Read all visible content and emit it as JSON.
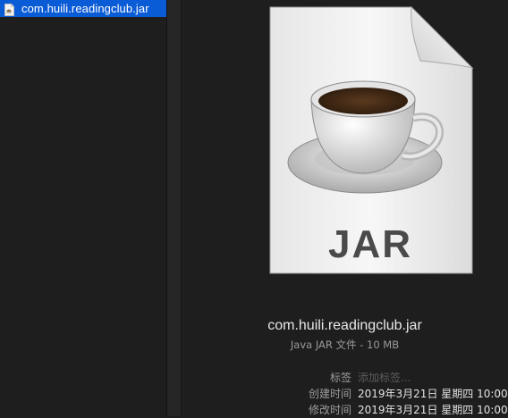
{
  "sidebar": {
    "selected_file": "com.huili.readingclub.jar",
    "selected_icon": "jar-file-icon"
  },
  "preview": {
    "icon": "jar-file-icon",
    "icon_caption": "JAR",
    "file_name": "com.huili.readingclub.jar",
    "file_kind": "Java JAR 文件 - 10 MB",
    "tags_label": "标签",
    "tags_placeholder": "添加标签...",
    "created_label": "创建时间",
    "created_value": "2019年3月21日 星期四 10:00",
    "modified_label": "修改时间",
    "modified_value": "2019年3月21日 星期四 10:00"
  },
  "colors": {
    "selection": "#0a5bd6",
    "background": "#1e1e1e"
  }
}
